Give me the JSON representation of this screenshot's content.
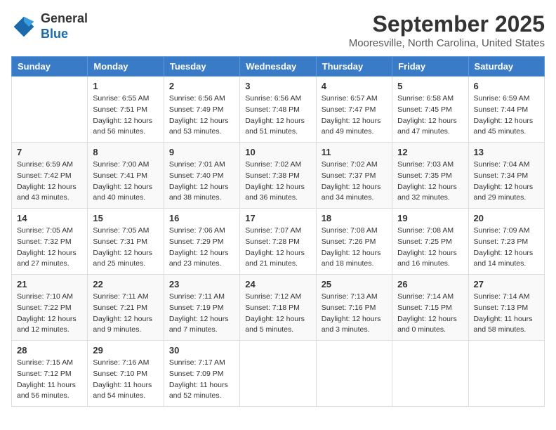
{
  "logo": {
    "general": "General",
    "blue": "Blue"
  },
  "header": {
    "month": "September 2025",
    "location": "Mooresville, North Carolina, United States"
  },
  "weekdays": [
    "Sunday",
    "Monday",
    "Tuesday",
    "Wednesday",
    "Thursday",
    "Friday",
    "Saturday"
  ],
  "weeks": [
    [
      {
        "day": "",
        "sunrise": "",
        "sunset": "",
        "daylight": ""
      },
      {
        "day": "1",
        "sunrise": "Sunrise: 6:55 AM",
        "sunset": "Sunset: 7:51 PM",
        "daylight": "Daylight: 12 hours and 56 minutes."
      },
      {
        "day": "2",
        "sunrise": "Sunrise: 6:56 AM",
        "sunset": "Sunset: 7:49 PM",
        "daylight": "Daylight: 12 hours and 53 minutes."
      },
      {
        "day": "3",
        "sunrise": "Sunrise: 6:56 AM",
        "sunset": "Sunset: 7:48 PM",
        "daylight": "Daylight: 12 hours and 51 minutes."
      },
      {
        "day": "4",
        "sunrise": "Sunrise: 6:57 AM",
        "sunset": "Sunset: 7:47 PM",
        "daylight": "Daylight: 12 hours and 49 minutes."
      },
      {
        "day": "5",
        "sunrise": "Sunrise: 6:58 AM",
        "sunset": "Sunset: 7:45 PM",
        "daylight": "Daylight: 12 hours and 47 minutes."
      },
      {
        "day": "6",
        "sunrise": "Sunrise: 6:59 AM",
        "sunset": "Sunset: 7:44 PM",
        "daylight": "Daylight: 12 hours and 45 minutes."
      }
    ],
    [
      {
        "day": "7",
        "sunrise": "Sunrise: 6:59 AM",
        "sunset": "Sunset: 7:42 PM",
        "daylight": "Daylight: 12 hours and 43 minutes."
      },
      {
        "day": "8",
        "sunrise": "Sunrise: 7:00 AM",
        "sunset": "Sunset: 7:41 PM",
        "daylight": "Daylight: 12 hours and 40 minutes."
      },
      {
        "day": "9",
        "sunrise": "Sunrise: 7:01 AM",
        "sunset": "Sunset: 7:40 PM",
        "daylight": "Daylight: 12 hours and 38 minutes."
      },
      {
        "day": "10",
        "sunrise": "Sunrise: 7:02 AM",
        "sunset": "Sunset: 7:38 PM",
        "daylight": "Daylight: 12 hours and 36 minutes."
      },
      {
        "day": "11",
        "sunrise": "Sunrise: 7:02 AM",
        "sunset": "Sunset: 7:37 PM",
        "daylight": "Daylight: 12 hours and 34 minutes."
      },
      {
        "day": "12",
        "sunrise": "Sunrise: 7:03 AM",
        "sunset": "Sunset: 7:35 PM",
        "daylight": "Daylight: 12 hours and 32 minutes."
      },
      {
        "day": "13",
        "sunrise": "Sunrise: 7:04 AM",
        "sunset": "Sunset: 7:34 PM",
        "daylight": "Daylight: 12 hours and 29 minutes."
      }
    ],
    [
      {
        "day": "14",
        "sunrise": "Sunrise: 7:05 AM",
        "sunset": "Sunset: 7:32 PM",
        "daylight": "Daylight: 12 hours and 27 minutes."
      },
      {
        "day": "15",
        "sunrise": "Sunrise: 7:05 AM",
        "sunset": "Sunset: 7:31 PM",
        "daylight": "Daylight: 12 hours and 25 minutes."
      },
      {
        "day": "16",
        "sunrise": "Sunrise: 7:06 AM",
        "sunset": "Sunset: 7:29 PM",
        "daylight": "Daylight: 12 hours and 23 minutes."
      },
      {
        "day": "17",
        "sunrise": "Sunrise: 7:07 AM",
        "sunset": "Sunset: 7:28 PM",
        "daylight": "Daylight: 12 hours and 21 minutes."
      },
      {
        "day": "18",
        "sunrise": "Sunrise: 7:08 AM",
        "sunset": "Sunset: 7:26 PM",
        "daylight": "Daylight: 12 hours and 18 minutes."
      },
      {
        "day": "19",
        "sunrise": "Sunrise: 7:08 AM",
        "sunset": "Sunset: 7:25 PM",
        "daylight": "Daylight: 12 hours and 16 minutes."
      },
      {
        "day": "20",
        "sunrise": "Sunrise: 7:09 AM",
        "sunset": "Sunset: 7:23 PM",
        "daylight": "Daylight: 12 hours and 14 minutes."
      }
    ],
    [
      {
        "day": "21",
        "sunrise": "Sunrise: 7:10 AM",
        "sunset": "Sunset: 7:22 PM",
        "daylight": "Daylight: 12 hours and 12 minutes."
      },
      {
        "day": "22",
        "sunrise": "Sunrise: 7:11 AM",
        "sunset": "Sunset: 7:21 PM",
        "daylight": "Daylight: 12 hours and 9 minutes."
      },
      {
        "day": "23",
        "sunrise": "Sunrise: 7:11 AM",
        "sunset": "Sunset: 7:19 PM",
        "daylight": "Daylight: 12 hours and 7 minutes."
      },
      {
        "day": "24",
        "sunrise": "Sunrise: 7:12 AM",
        "sunset": "Sunset: 7:18 PM",
        "daylight": "Daylight: 12 hours and 5 minutes."
      },
      {
        "day": "25",
        "sunrise": "Sunrise: 7:13 AM",
        "sunset": "Sunset: 7:16 PM",
        "daylight": "Daylight: 12 hours and 3 minutes."
      },
      {
        "day": "26",
        "sunrise": "Sunrise: 7:14 AM",
        "sunset": "Sunset: 7:15 PM",
        "daylight": "Daylight: 12 hours and 0 minutes."
      },
      {
        "day": "27",
        "sunrise": "Sunrise: 7:14 AM",
        "sunset": "Sunset: 7:13 PM",
        "daylight": "Daylight: 11 hours and 58 minutes."
      }
    ],
    [
      {
        "day": "28",
        "sunrise": "Sunrise: 7:15 AM",
        "sunset": "Sunset: 7:12 PM",
        "daylight": "Daylight: 11 hours and 56 minutes."
      },
      {
        "day": "29",
        "sunrise": "Sunrise: 7:16 AM",
        "sunset": "Sunset: 7:10 PM",
        "daylight": "Daylight: 11 hours and 54 minutes."
      },
      {
        "day": "30",
        "sunrise": "Sunrise: 7:17 AM",
        "sunset": "Sunset: 7:09 PM",
        "daylight": "Daylight: 11 hours and 52 minutes."
      },
      {
        "day": "",
        "sunrise": "",
        "sunset": "",
        "daylight": ""
      },
      {
        "day": "",
        "sunrise": "",
        "sunset": "",
        "daylight": ""
      },
      {
        "day": "",
        "sunrise": "",
        "sunset": "",
        "daylight": ""
      },
      {
        "day": "",
        "sunrise": "",
        "sunset": "",
        "daylight": ""
      }
    ]
  ]
}
